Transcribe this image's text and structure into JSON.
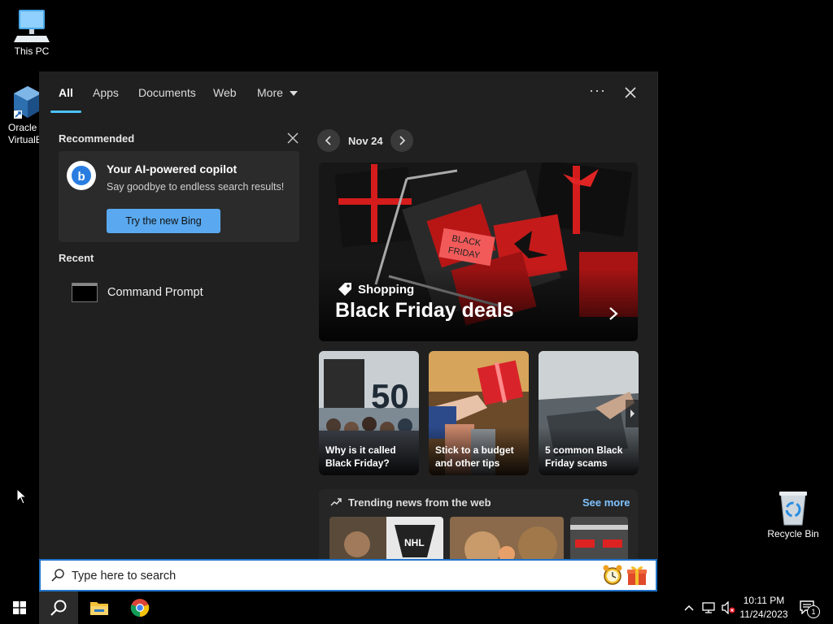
{
  "desktop": {
    "icons": [
      {
        "label": "This PC"
      },
      {
        "label": "Oracle VirtualBox"
      },
      {
        "label": "Recycle Bin"
      }
    ]
  },
  "search_panel": {
    "tabs": [
      {
        "label": "All",
        "active": true
      },
      {
        "label": "Apps"
      },
      {
        "label": "Documents"
      },
      {
        "label": "Web"
      },
      {
        "label": "More"
      }
    ],
    "options_icon": "more-options-icon",
    "close_icon": "close-icon",
    "recommended": {
      "heading": "Recommended",
      "card": {
        "title": "Your AI-powered copilot",
        "subtitle": "Say goodbye to endless search results!",
        "button_label": "Try the new Bing"
      }
    },
    "recent": {
      "heading": "Recent",
      "items": [
        {
          "label": "Command Prompt",
          "icon": "command-prompt-icon"
        }
      ]
    },
    "highlights": {
      "date": "Nov 24",
      "hero": {
        "category": "Shopping",
        "title": "Black Friday deals",
        "sign_text_1": "BLACK",
        "sign_text_2": "FRIDAY"
      },
      "tiles": [
        {
          "caption": "Why is it called Black Friday?",
          "overlay_text": "50"
        },
        {
          "caption": "Stick to a budget and other tips"
        },
        {
          "caption": "5 common Black Friday scams"
        }
      ],
      "trending": {
        "title": "Trending news from the web",
        "see_more": "See more"
      }
    }
  },
  "search_bar": {
    "placeholder": "Type here to search"
  },
  "taskbar": {
    "time": "10:11 PM",
    "date": "11/24/2023",
    "notification_count": "1"
  },
  "colors": {
    "accent": "#4cc2ff",
    "panel_bg": "#202020",
    "button_bg": "#5aa9f0",
    "link": "#7fc3ff"
  }
}
